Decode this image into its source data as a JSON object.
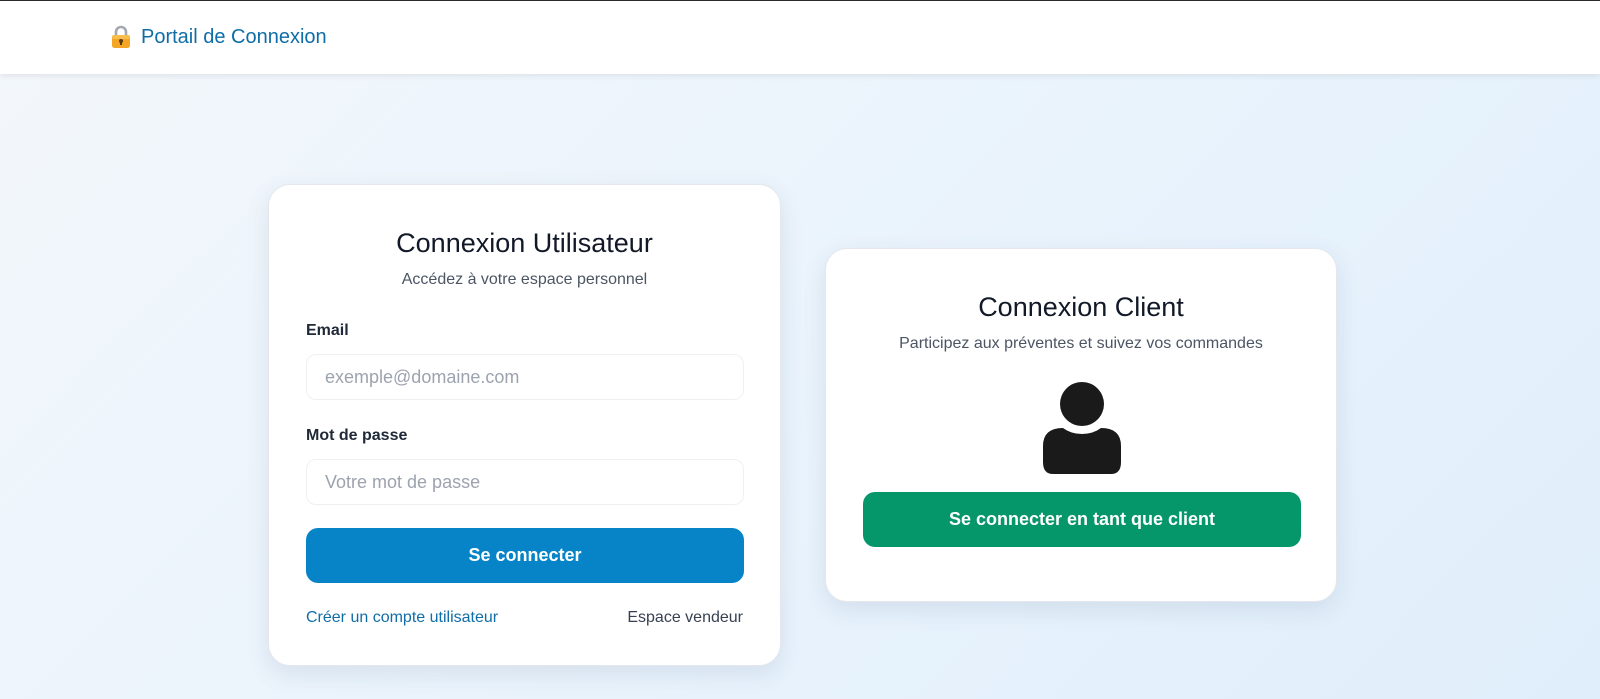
{
  "navbar": {
    "brand_label": "Portail de Connexion",
    "brand_icon": "lock-icon"
  },
  "user_login": {
    "title": "Connexion Utilisateur",
    "subtitle": "Accédez à votre espace personnel",
    "email_label": "Email",
    "email_placeholder": "exemple@domaine.com",
    "email_value": "",
    "password_label": "Mot de passe",
    "password_placeholder": "Votre mot de passe",
    "password_value": "",
    "submit_label": "Se connecter",
    "create_account_link": "Créer un compte utilisateur",
    "seller_link": "Espace vendeur"
  },
  "client_login": {
    "title": "Connexion Client",
    "subtitle": "Participez aux préventes et suivez vos commandes",
    "avatar_icon": "user-icon",
    "button_label": "Se connecter en tant que client"
  },
  "colors": {
    "brand": "#0f6da8",
    "primary_button": "#0784c8",
    "client_button": "#059669",
    "text_dark": "#111827"
  }
}
